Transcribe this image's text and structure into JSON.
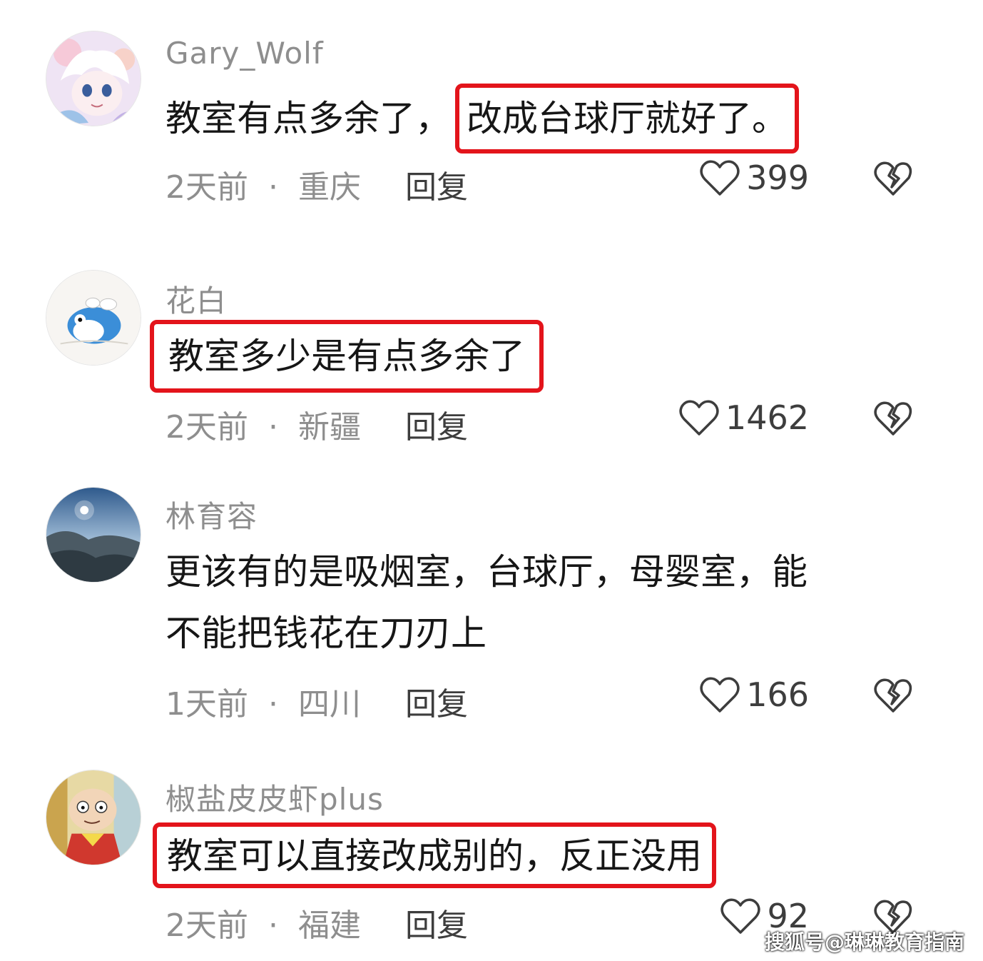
{
  "comments": [
    {
      "username": "Gary_Wolf",
      "text_plain": "教室有点多余了，",
      "text_highlight": "改成台球厅就好了。",
      "time": "2天前",
      "separator": "·",
      "location": "重庆",
      "reply_label": "回复",
      "likes": "399",
      "avatar_icon": "anime-character-avatar"
    },
    {
      "username": "花白",
      "text_plain": "",
      "text_highlight": "教室多少是有点多余了",
      "time": "2天前",
      "separator": "·",
      "location": "新疆",
      "reply_label": "回复",
      "likes": "1462",
      "avatar_icon": "doraemon-avatar"
    },
    {
      "username": "林育容",
      "text_line1": "更该有的是吸烟室，台球厅，母婴室，能",
      "text_line2": "不能把钱花在刀刃上",
      "time": "1天前",
      "separator": "·",
      "location": "四川",
      "reply_label": "回复",
      "likes": "166",
      "avatar_icon": "mountain-landscape-avatar"
    },
    {
      "username": "椒盐皮皮虾plus",
      "text_plain": "",
      "text_highlight": "教室可以直接改成别的，反正没用",
      "time": "2天前",
      "separator": "·",
      "location": "福建",
      "reply_label": "回复",
      "likes": "92",
      "avatar_icon": "cartoon-character-avatar"
    }
  ],
  "watermark": "搜狐号@琳琳教育指南",
  "colors": {
    "highlight_border": "#e3141b",
    "meta_text": "#8e8e8e",
    "body_text": "#161616"
  }
}
